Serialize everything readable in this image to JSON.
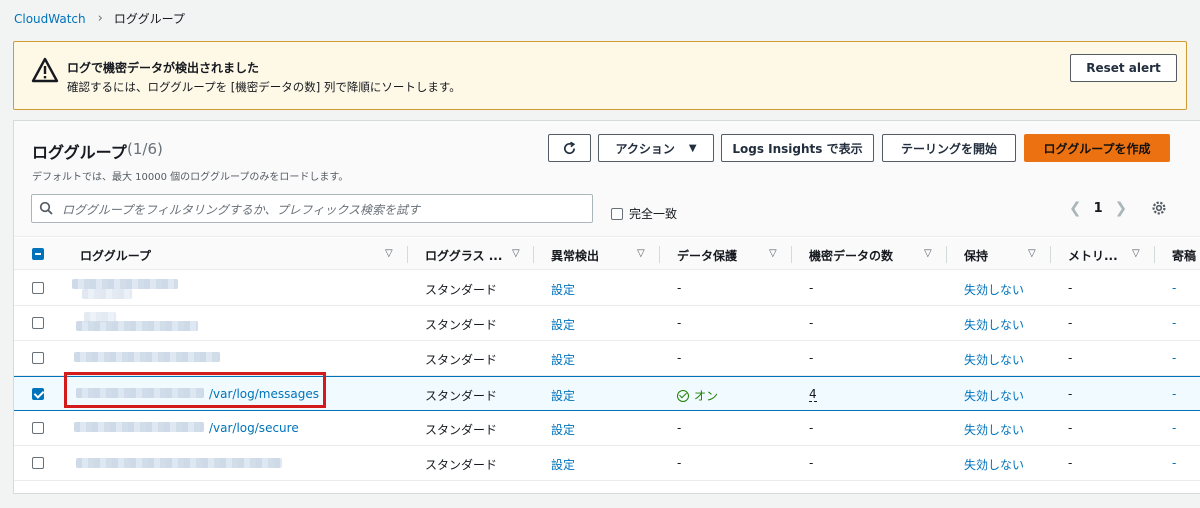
{
  "breadcrumb": {
    "root": "CloudWatch",
    "current": "ロググループ"
  },
  "alert": {
    "title": "ログで機密データが検出されました",
    "description": "確認するには、ロググループを [機密データの数] 列で降順にソートします。",
    "reset_label": "Reset alert",
    "icon": "warning-icon"
  },
  "panel": {
    "title": "ロググループ",
    "count": "(1/6)",
    "subtitle": "デフォルトでは、最大 10000 個のロググループのみをロードします。",
    "buttons": {
      "actions": "アクション",
      "insights": "Logs Insights で表示",
      "tail": "テーリングを開始",
      "create": "ロググループを作成"
    },
    "search_placeholder": "ロググループをフィルタリングするか、プレフィックス検索を試す",
    "exact_match": "完全一致",
    "page": "1"
  },
  "columns": {
    "log_group": "ロググループ",
    "log_class": "ロググラス ...",
    "anomaly": "異常検出",
    "protection": "データ保護",
    "sensitive": "機密データの数",
    "retention": "保持",
    "metric": "メトリ...",
    "contributor": "寄稿"
  },
  "rows": [
    {
      "name": "",
      "class": "スタンダード",
      "anomaly": "設定",
      "protection": "-",
      "sensitive": "-",
      "retention": "失効しない",
      "metric": "-",
      "contributor": "-",
      "selected": false
    },
    {
      "name": "",
      "class": "スタンダード",
      "anomaly": "設定",
      "protection": "-",
      "sensitive": "-",
      "retention": "失効しない",
      "metric": "-",
      "contributor": "-",
      "selected": false
    },
    {
      "name": "",
      "class": "スタンダード",
      "anomaly": "設定",
      "protection": "-",
      "sensitive": "-",
      "retention": "失効しない",
      "metric": "-",
      "contributor": "-",
      "selected": false
    },
    {
      "name": "/var/log/messages",
      "class": "スタンダード",
      "anomaly": "設定",
      "protection": "オン",
      "sensitive": "4",
      "retention": "失効しない",
      "metric": "-",
      "contributor": "-",
      "selected": true
    },
    {
      "name": "/var/log/secure",
      "class": "スタンダード",
      "anomaly": "設定",
      "protection": "-",
      "sensitive": "-",
      "retention": "失効しない",
      "metric": "-",
      "contributor": "-",
      "selected": false
    },
    {
      "name": "",
      "class": "スタンダード",
      "anomaly": "設定",
      "protection": "-",
      "sensitive": "-",
      "retention": "失効しない",
      "metric": "-",
      "contributor": "-",
      "selected": false
    }
  ],
  "colors": {
    "accent": "#0073bb",
    "primary_button": "#ec7211",
    "warning_border": "#d29b32",
    "highlight": "#d31b1b"
  }
}
